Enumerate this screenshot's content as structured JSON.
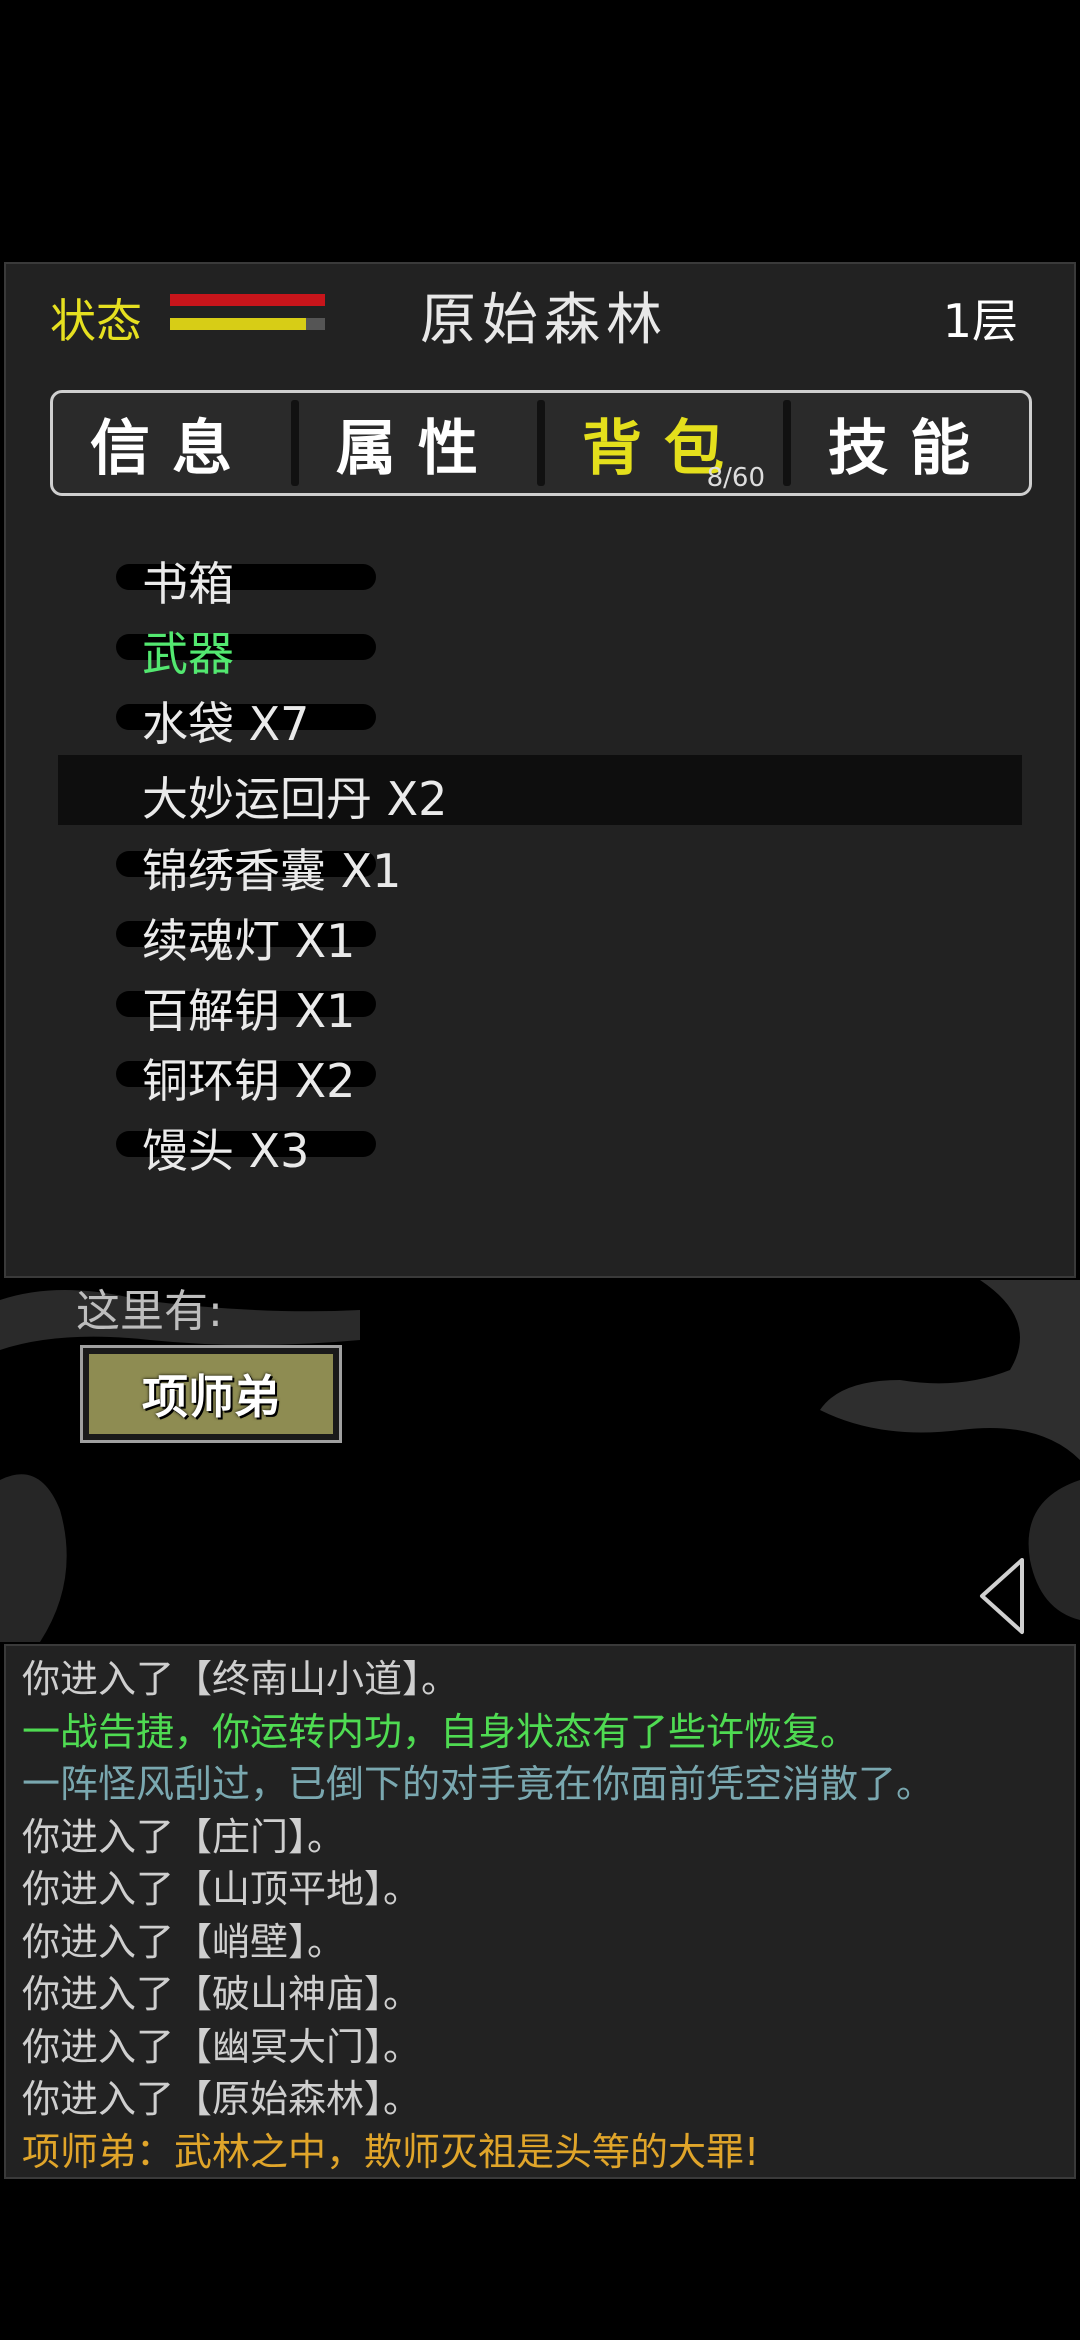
{
  "header": {
    "status_label": "状态",
    "hp_fraction": 1.0,
    "mp_fraction": 0.88,
    "location": "原始森林",
    "floor": "1层",
    "colors": {
      "status": "#e6e020",
      "hp": "#c8151b",
      "mp": "#d7cd16"
    }
  },
  "tabs": [
    {
      "label": "信息"
    },
    {
      "label": "属性"
    },
    {
      "label": "背包",
      "count": "8/60"
    },
    {
      "label": "技能"
    }
  ],
  "inventory": [
    {
      "label": "书箱"
    },
    {
      "label": "武器"
    },
    {
      "label": "水袋 X7"
    },
    {
      "label": "大妙运回丹 X2"
    },
    {
      "label": "锦绣香囊 X1"
    },
    {
      "label": "续魂灯 X1"
    },
    {
      "label": "百解钥 X1"
    },
    {
      "label": "铜环钥 X2"
    },
    {
      "label": "馒头 X3"
    }
  ],
  "scene": {
    "here_label": "这里有:",
    "npc_label": "项师弟"
  },
  "log": [
    {
      "text": "你进入了【终南山小道】。",
      "color": "#cfcfcf"
    },
    {
      "text": "一战告捷，你运转内功，自身状态有了些许恢复。",
      "color": "#4fdb52"
    },
    {
      "text": "一阵怪风刮过，已倒下的对手竟在你面前凭空消散了。",
      "color": "#7aa8b0"
    },
    {
      "text": "你进入了【庄门】。",
      "color": "#cfcfcf"
    },
    {
      "text": "你进入了【山顶平地】。",
      "color": "#cfcfcf"
    },
    {
      "text": "你进入了【峭壁】。",
      "color": "#cfcfcf"
    },
    {
      "text": "你进入了【破山神庙】。",
      "color": "#cfcfcf"
    },
    {
      "text": "你进入了【幽冥大门】。",
      "color": "#cfcfcf"
    },
    {
      "text": "你进入了【原始森林】。",
      "color": "#cfcfcf"
    },
    {
      "text": "项师弟：武林之中，欺师灭祖是头等的大罪!",
      "color": "#e0a52a"
    }
  ]
}
